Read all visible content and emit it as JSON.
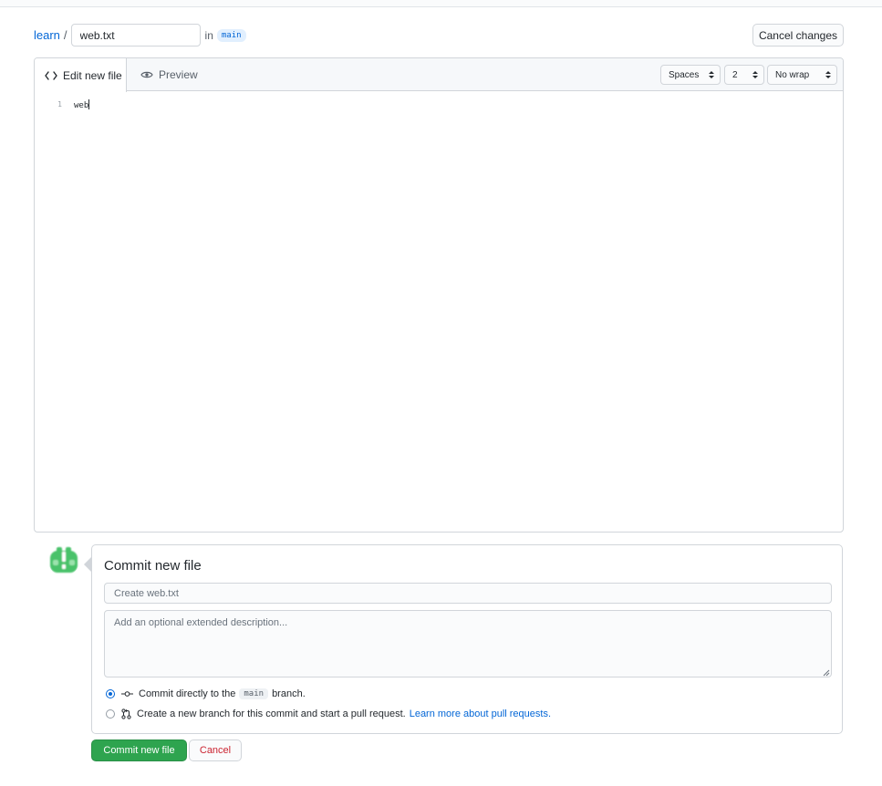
{
  "breadcrumb": {
    "repo": "learn",
    "separator": "/",
    "filename": "web.txt",
    "in_label": "in",
    "branch": "main"
  },
  "header": {
    "cancel_changes_label": "Cancel changes"
  },
  "editor": {
    "tabs": [
      {
        "label": "Edit new file",
        "icon": "code-icon",
        "active": true
      },
      {
        "label": "Preview",
        "icon": "eye-icon",
        "active": false
      }
    ],
    "indent_mode": "Spaces",
    "indent_size": "2",
    "wrap_mode": "No wrap",
    "lines": [
      {
        "number": "1",
        "text": "web"
      }
    ]
  },
  "commit": {
    "title": "Commit new file",
    "summary_placeholder": "Create web.txt",
    "description_placeholder": "Add an optional extended description...",
    "option_direct": {
      "prefix": "Commit directly to the",
      "branch": "main",
      "suffix": "branch.",
      "selected": true
    },
    "option_new_branch": {
      "text": "Create a new branch for this commit and start a pull request.",
      "link": "Learn more about pull requests.",
      "selected": false
    },
    "submit_label": "Commit new file",
    "cancel_label": "Cancel"
  },
  "colors": {
    "link": "#0366d6",
    "primary_button": "#2ea44f",
    "danger_text": "#cb2431",
    "avatar": "#4ac26b"
  }
}
